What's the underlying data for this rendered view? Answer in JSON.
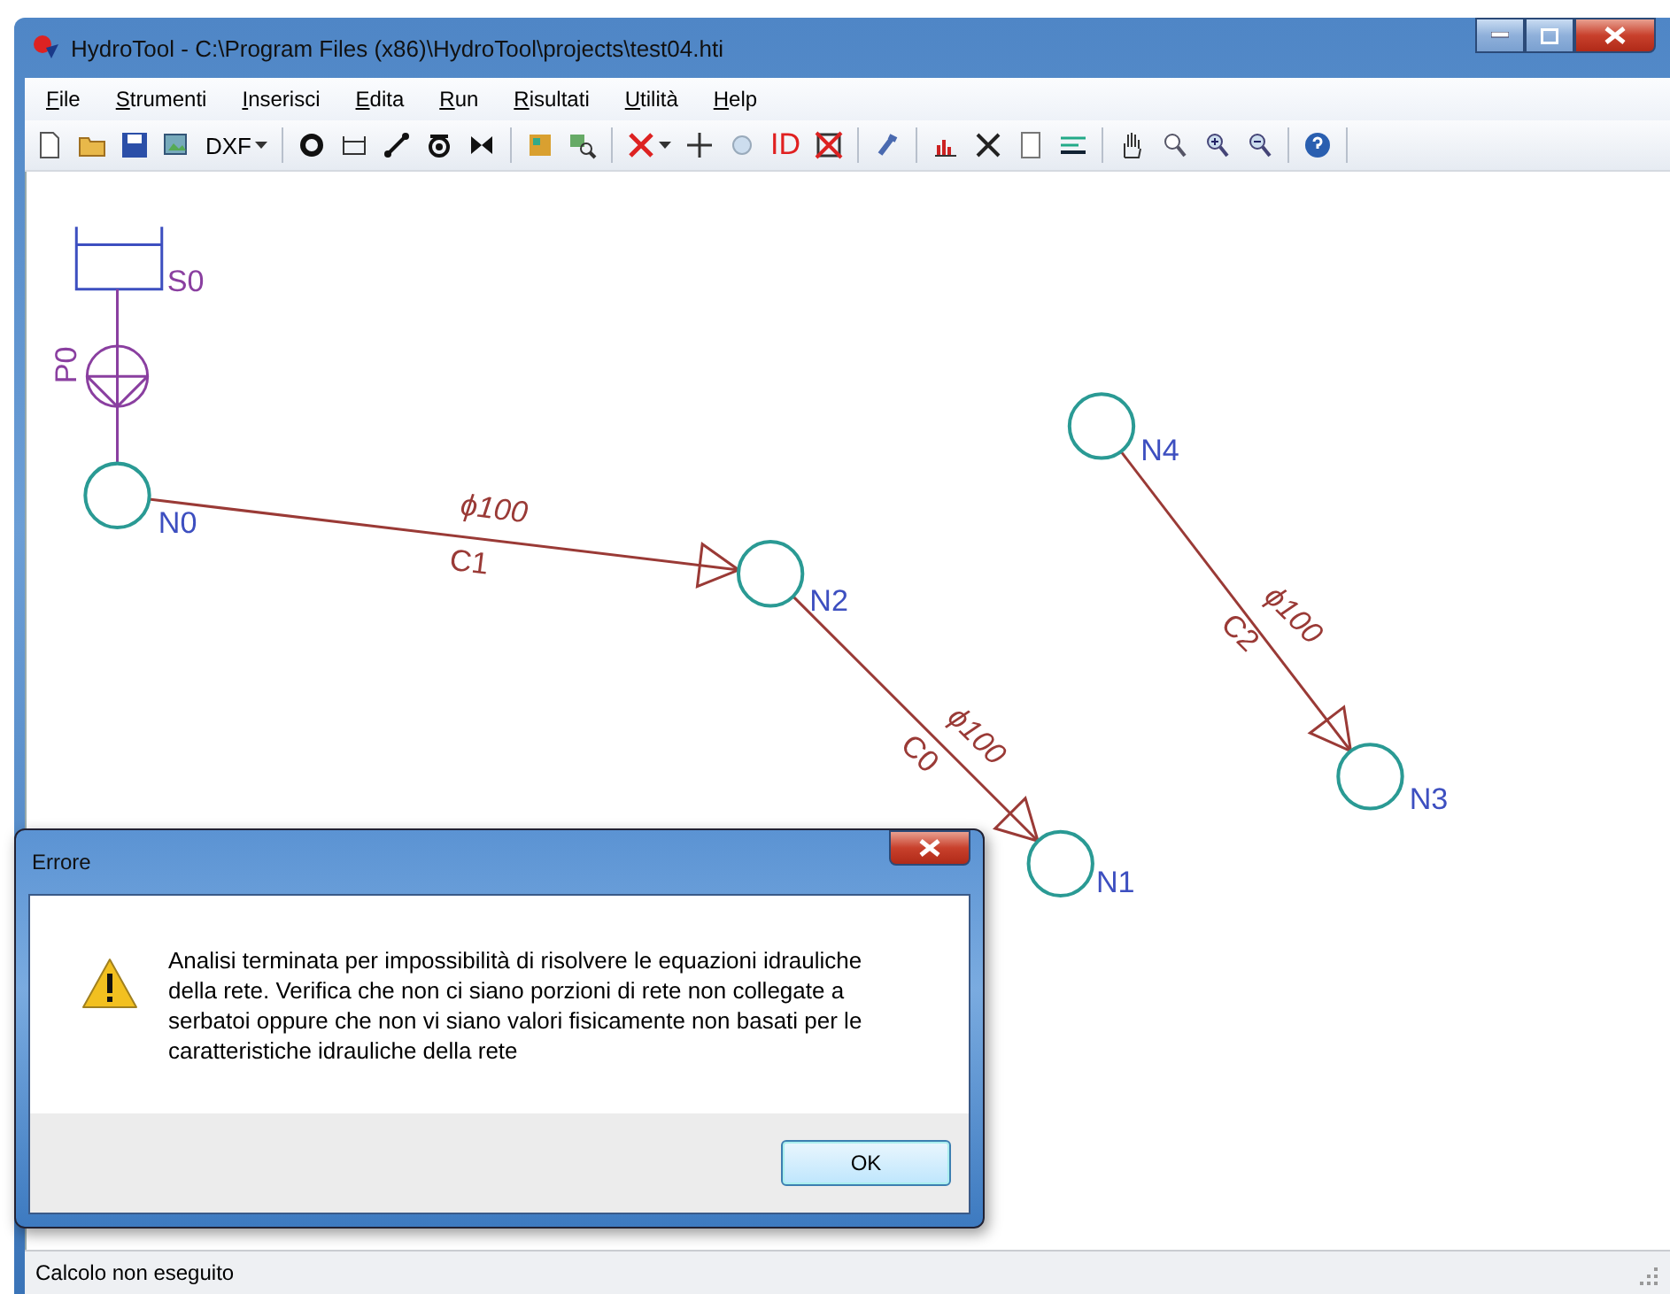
{
  "window": {
    "title": "HydroTool - C:\\Program Files (x86)\\HydroTool\\projects\\test04.hti"
  },
  "menu": [
    {
      "label": "File"
    },
    {
      "label": "Strumenti"
    },
    {
      "label": "Inserisci"
    },
    {
      "label": "Edita"
    },
    {
      "label": "Run"
    },
    {
      "label": "Risultati"
    },
    {
      "label": "Utilità"
    },
    {
      "label": "Help"
    }
  ],
  "toolbar": {
    "dxf_label": "DXF",
    "id_label": "ID"
  },
  "diagram": {
    "reservoir": {
      "label": "S0"
    },
    "pump": {
      "label": "P0"
    },
    "nodes": [
      {
        "label": "N0"
      },
      {
        "label": "N2"
      },
      {
        "label": "N1"
      },
      {
        "label": "N4"
      },
      {
        "label": "N3"
      }
    ],
    "pipes": [
      {
        "diameter": "ϕ100",
        "label": "C1"
      },
      {
        "diameter": "ϕ100",
        "label": "C0"
      },
      {
        "diameter": "ϕ100",
        "label": "C2"
      }
    ]
  },
  "dialog": {
    "title": "Errore",
    "message": "Analisi terminata per impossibilità di risolvere le equazioni idrauliche della rete. Verifica che non ci siano porzioni di rete non collegate a serbatoi oppure che non vi siano valori fisicamente non basati per le caratteristiche idrauliche della rete",
    "button": "OK"
  },
  "status_bar": {
    "text": "Calcolo non eseguito"
  }
}
